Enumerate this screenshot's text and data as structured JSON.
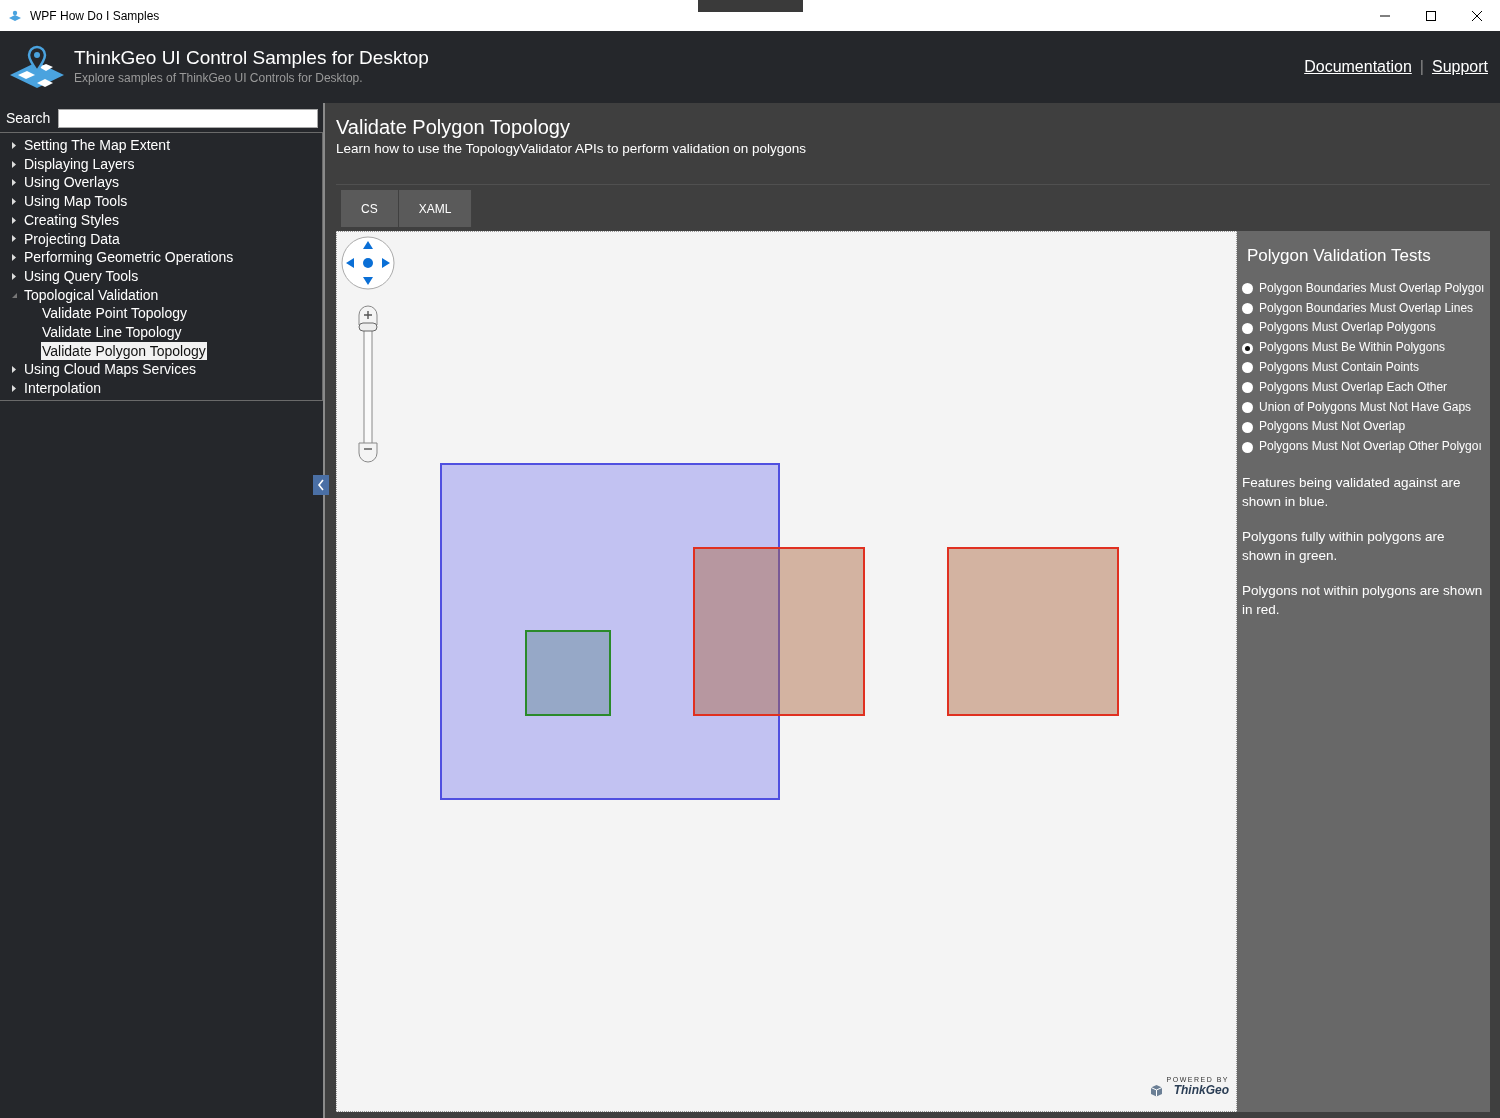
{
  "window": {
    "title": "WPF How Do I Samples"
  },
  "header": {
    "title": "ThinkGeo UI Control Samples for Desktop",
    "subtitle": "Explore samples of ThinkGeo UI Controls for Desktop.",
    "links": [
      "Documentation",
      "Support"
    ],
    "separator": "|"
  },
  "sidebar": {
    "search_label": "Search",
    "items": [
      {
        "label": "Setting The Map Extent",
        "expanded": false,
        "selected": false
      },
      {
        "label": "Displaying Layers",
        "expanded": false,
        "selected": false
      },
      {
        "label": "Using Overlays",
        "expanded": false,
        "selected": false
      },
      {
        "label": "Using Map Tools",
        "expanded": false,
        "selected": false
      },
      {
        "label": "Creating Styles",
        "expanded": false,
        "selected": false
      },
      {
        "label": "Projecting Data",
        "expanded": false,
        "selected": false
      },
      {
        "label": "Performing Geometric Operations",
        "expanded": false,
        "selected": false
      },
      {
        "label": "Using Query Tools",
        "expanded": false,
        "selected": false
      },
      {
        "label": "Topological Validation",
        "expanded": true,
        "selected": false,
        "children": [
          {
            "label": "Validate Point Topology",
            "selected": false
          },
          {
            "label": "Validate Line Topology",
            "selected": false
          },
          {
            "label": "Validate Polygon Topology",
            "selected": true
          }
        ]
      },
      {
        "label": "Using Cloud Maps Services",
        "expanded": false,
        "selected": false
      },
      {
        "label": "Interpolation",
        "expanded": false,
        "selected": false
      }
    ]
  },
  "sample": {
    "title": "Validate Polygon Topology",
    "description": "Learn how to use the TopologyValidator APIs to perform validation on polygons"
  },
  "tabs": [
    {
      "label": "CS"
    },
    {
      "label": "XAML"
    }
  ],
  "map": {
    "zoom_slider": {
      "level": 1
    },
    "features": [
      {
        "kind": "validated-against",
        "color": "#5050e0"
      },
      {
        "kind": "within",
        "color": "#2a8a2a"
      },
      {
        "kind": "not-within",
        "color": "#e03020"
      },
      {
        "kind": "not-within",
        "color": "#e03020"
      }
    ],
    "credit": {
      "top": "POWERED BY",
      "brand": "ThinkGeo"
    }
  },
  "panel": {
    "title": "Polygon Validation Tests",
    "tests": [
      {
        "label": "Polygon Boundaries Must Overlap Polygoı",
        "selected": false
      },
      {
        "label": "Polygon Boundaries Must Overlap Lines",
        "selected": false
      },
      {
        "label": "Polygons Must Overlap Polygons",
        "selected": false
      },
      {
        "label": "Polygons Must Be Within Polygons",
        "selected": true
      },
      {
        "label": "Polygons Must Contain Points",
        "selected": false
      },
      {
        "label": "Polygons Must Overlap Each Other",
        "selected": false
      },
      {
        "label": "Union of Polygons Must Not Have Gaps",
        "selected": false
      },
      {
        "label": "Polygons Must Not Overlap",
        "selected": false
      },
      {
        "label": "Polygons Must Not Overlap Other Polygoı",
        "selected": false
      }
    ],
    "notes": [
      "Features being validated against are shown in blue.",
      "Polygons fully within polygons are shown in green.",
      "Polygons not within polygons are shown in red."
    ]
  }
}
